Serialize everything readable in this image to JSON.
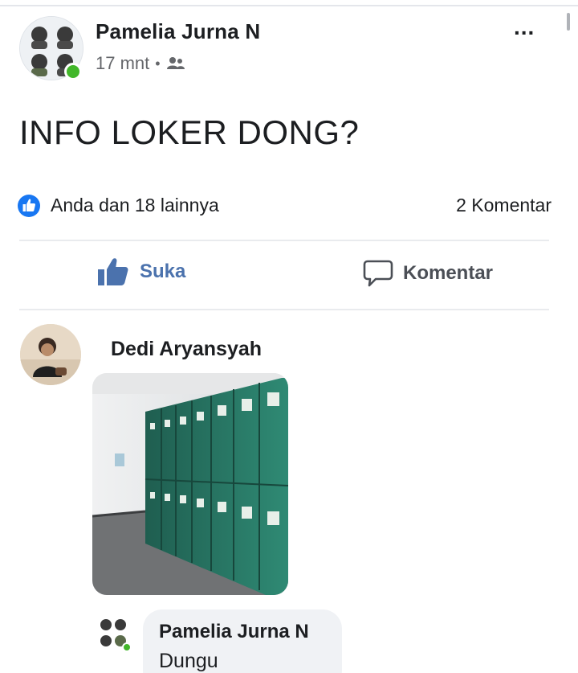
{
  "post": {
    "author": "Pamelia Jurna N",
    "time": "17 mnt",
    "separator": "•",
    "audience_icon": "friends-icon",
    "more": "...",
    "text": "INFO LOKER DONG?"
  },
  "reactions": {
    "icon": "like-icon",
    "summary": "Anda dan 18 lainnya",
    "comment_count": "2 Komentar"
  },
  "actions": {
    "like_label": "Suka",
    "comment_label": "Komentar"
  },
  "comments": [
    {
      "author": "Dedi Aryansyah",
      "attachment": "photo-lockers"
    }
  ],
  "replies": [
    {
      "author": "Pamelia Jurna N",
      "text": "Dungu"
    }
  ],
  "colors": {
    "accent": "#1877f2",
    "action_like": "#4b72ad",
    "online": "#42b72a",
    "secondary_text": "#65676b",
    "locker_green": "#2f7f6c"
  }
}
